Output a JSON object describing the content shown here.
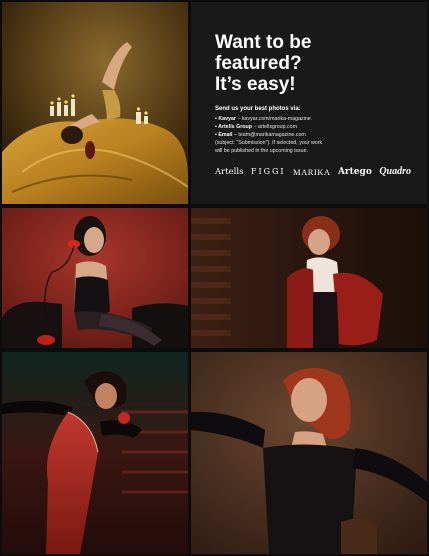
{
  "feature": {
    "headline": [
      "Want to be",
      "featured?",
      "It’s easy!"
    ],
    "intro": "Send us your best photos via:",
    "lines": [
      {
        "label": "• Kavyar",
        "rest": " – kavyar.com/marika-magazine"
      },
      {
        "label": "• Artells Group",
        "rest": " – artellsgroup.com"
      },
      {
        "label": "• Email",
        "rest": " – team@marikamagazine.com"
      },
      {
        "label": "",
        "rest": "(subject: “Submission”). If selected, your work"
      },
      {
        "label": "",
        "rest": "will be published in the upcoming issue."
      }
    ],
    "logos": {
      "artells": "Artells",
      "figgi": "FIGGI",
      "marika": "MARIKA",
      "artego": "Artego",
      "quadro": "Quadro"
    }
  }
}
